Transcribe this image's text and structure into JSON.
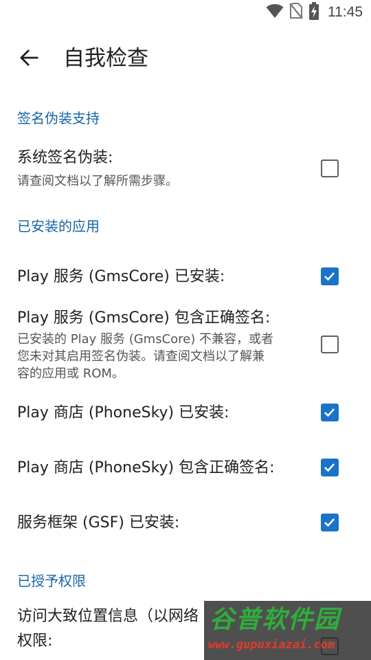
{
  "status_bar": {
    "time": "11:45",
    "icons": [
      "wifi-icon",
      "no-sim-icon",
      "battery-charging-icon"
    ]
  },
  "app_bar": {
    "title": "自我检查",
    "back_icon": "arrow-left-icon"
  },
  "sections": [
    {
      "header": "签名伪装支持",
      "items": [
        {
          "title": "系统签名伪装:",
          "summary": "请查阅文档以了解所需步骤。",
          "checked": false
        }
      ]
    },
    {
      "header": "已安装的应用",
      "items": [
        {
          "title": "Play 服务 (GmsCore) 已安装:",
          "summary": "",
          "checked": true
        },
        {
          "title": "Play 服务 (GmsCore) 包含正确签名:",
          "summary_lines": [
            "已安装的 Play 服务 (GmsCore) 不兼容，或者",
            "您未对其启用签名伪装。请查阅文档以了解兼",
            "容的应用或 ROM。"
          ],
          "checked": false
        },
        {
          "title": "Play 商店 (PhoneSky) 已安装:",
          "summary": "",
          "checked": true
        },
        {
          "title": "Play 商店 (PhoneSky) 包含正确签名:",
          "summary": "",
          "checked": true
        },
        {
          "title": "服务框架 (GSF) 已安装:",
          "summary": "",
          "checked": true
        }
      ]
    },
    {
      "header": "已授予权限",
      "items": [
        {
          "title_lines": [
            "访问大致位置信息（以网络",
            "权限:"
          ],
          "summary": "",
          "checked": false
        }
      ]
    }
  ],
  "watermark": {
    "logo": "谷普软件园",
    "url": "www.gupuxiazai.com"
  },
  "colors": {
    "accent": "#1a73c8",
    "section_header": "#1565a6",
    "text_primary": "#202020",
    "text_secondary": "#555555"
  }
}
